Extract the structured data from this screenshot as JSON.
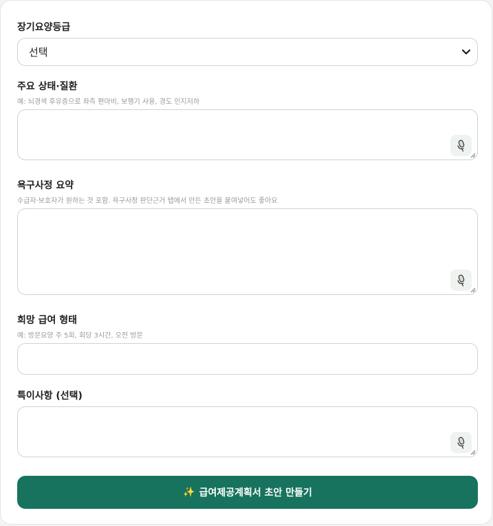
{
  "fields": {
    "grade": {
      "label": "장기요양등급",
      "selected": "선택"
    },
    "condition": {
      "label": "주요 상태·질환",
      "hint": "예: 뇌경색 후유증으로 좌측 편마비, 보행기 사용, 경도 인지저하",
      "value": ""
    },
    "needs": {
      "label": "욕구사정 요약",
      "hint": "수급자·보호자가 원하는 것 포함. 욕구사정 판단근거 탭에서 만든 초안을 붙여넣어도 좋아요",
      "value": ""
    },
    "service_type": {
      "label": "희망 급여 형태",
      "hint": "예: 방문요양 주 5회, 회당 3시간, 오전 방문",
      "value": ""
    },
    "notes": {
      "label": "특이사항 (선택)",
      "value": ""
    }
  },
  "submit": {
    "icon": "sparkles-icon",
    "label": "급여제공계획서 초안 만들기"
  },
  "icons": {
    "voice_input": "microphone-icon",
    "select_arrow": "chevron-down-icon"
  },
  "colors": {
    "primary": "#17735e",
    "border": "#cfd3d1",
    "mic_bg": "#eef3f0"
  }
}
